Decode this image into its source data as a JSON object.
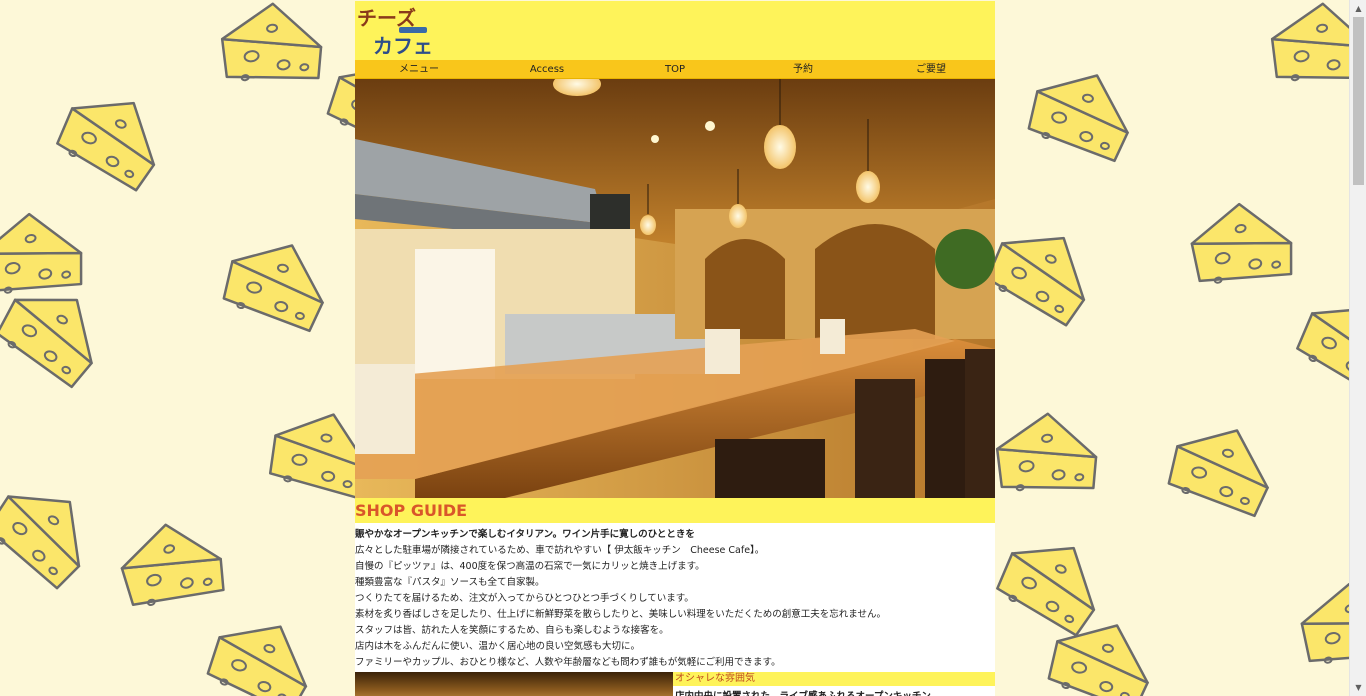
{
  "logo": {
    "line1": "チーズ",
    "line2": "カフェ"
  },
  "nav": [
    {
      "label": "メニュー"
    },
    {
      "label": "Access"
    },
    {
      "label": "TOP"
    },
    {
      "label": "予約"
    },
    {
      "label": "ご要望"
    }
  ],
  "section_title": "SHOP GUIDE",
  "guide": {
    "lead": "賑やかなオープンキッチンで楽しむイタリアン。ワイン片手に寛しのひとときを",
    "lines": [
      "広々とした駐車場が隣接されているため、車で訪れやすい【 伊太飯キッチン　Cheese Cafe】。",
      "自慢の『ピッツァ』は、400度を保つ高温の石窯で一気にカリッと焼き上げます。",
      "種類豊富な『パスタ』ソースも全て自家製。",
      "つくりたてを届けるため、注文が入ってからひとつひとつ手づくりしています。",
      "素材を炙り香ばしさを足したり、仕上げに新鮮野菜を散らしたりと、美味しい料理をいただくための創意工夫を忘れません。",
      "スタッフは皆、訪れた人を笑顔にするため、自らも楽しむような接客を。",
      "店内は木をふんだんに使い、温かく居心地の良い空気感も大切に。",
      "ファミリーやカップル、おひとり様など、人数や年齢層なども問わず誰もが気軽にご利用できます。"
    ]
  },
  "sub": {
    "title": "オシャレな雰囲気",
    "text": "店内中央に設置された、ライブ感あふれるオープンキッチン"
  },
  "colors": {
    "background": "#fdf8d8",
    "header": "#fef35a",
    "nav": "#f9c61b",
    "accent": "#d9562a"
  },
  "icons": {
    "scroll_up": "triangle-up-icon",
    "scroll_down": "triangle-down-icon"
  }
}
